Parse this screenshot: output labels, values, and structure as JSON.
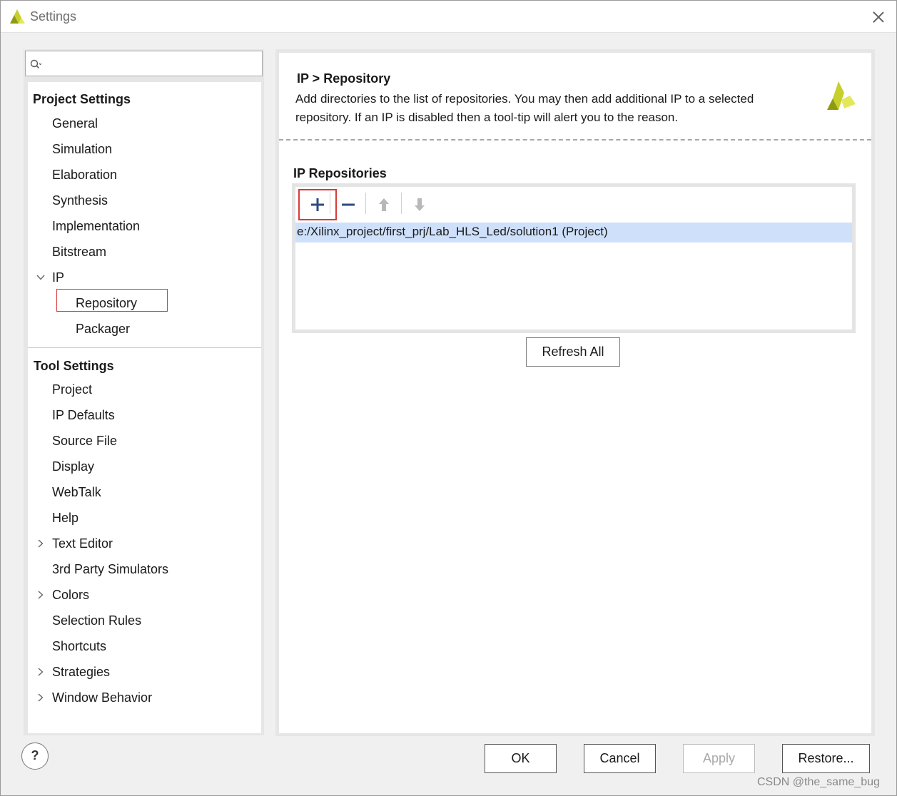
{
  "window": {
    "title": "Settings"
  },
  "search": {
    "placeholder": ""
  },
  "tree": {
    "project_settings_header": "Project Settings",
    "project_items": [
      "General",
      "Simulation",
      "Elaboration",
      "Synthesis",
      "Implementation",
      "Bitstream"
    ],
    "ip": {
      "label": "IP",
      "expanded": true,
      "children": [
        "Repository",
        "Packager"
      ],
      "selected": "Repository"
    },
    "tool_settings_header": "Tool Settings",
    "tool_items": [
      {
        "label": "Project",
        "expandable": false
      },
      {
        "label": "IP Defaults",
        "expandable": false
      },
      {
        "label": "Source File",
        "expandable": false
      },
      {
        "label": "Display",
        "expandable": false
      },
      {
        "label": "WebTalk",
        "expandable": false
      },
      {
        "label": "Help",
        "expandable": false
      },
      {
        "label": "Text Editor",
        "expandable": true
      },
      {
        "label": "3rd Party Simulators",
        "expandable": false
      },
      {
        "label": "Colors",
        "expandable": true
      },
      {
        "label": "Selection Rules",
        "expandable": false
      },
      {
        "label": "Shortcuts",
        "expandable": false
      },
      {
        "label": "Strategies",
        "expandable": true
      },
      {
        "label": "Window Behavior",
        "expandable": true
      }
    ]
  },
  "panel": {
    "title": "IP > Repository",
    "description": "Add directories to the list of repositories. You may then add additional IP to a selected repository. If an IP is disabled then a tool-tip will alert you to the reason.",
    "section_title": "IP Repositories",
    "toolbar_icons": [
      "add-icon",
      "remove-icon",
      "move-up-icon",
      "move-down-icon"
    ],
    "repositories": [
      "e:/Xilinx_project/first_prj/Lab_HLS_Led/solution1 (Project)"
    ],
    "refresh_label": "Refresh All"
  },
  "footer": {
    "help_label": "?",
    "ok_label": "OK",
    "cancel_label": "Cancel",
    "apply_label": "Apply",
    "restore_label": "Restore..."
  },
  "watermark": "CSDN @the_same_bug",
  "colors": {
    "selection_bg": "#cfe0fb",
    "highlight_red": "#d93a3a",
    "toolbar_blue": "#2d4a82",
    "logo_yellow": "#e3e85a",
    "logo_olive": "#8f9a12"
  }
}
